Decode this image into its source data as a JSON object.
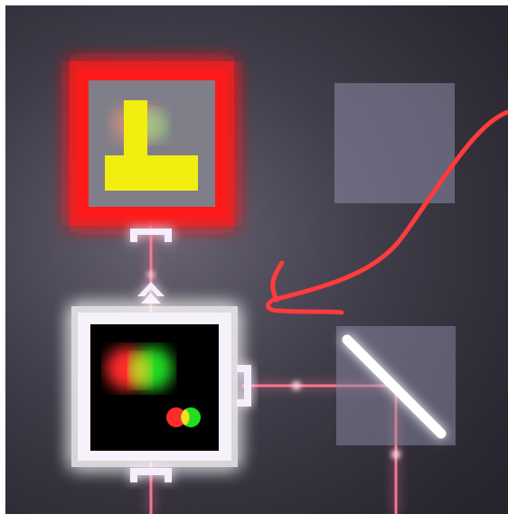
{
  "puzzle": {
    "background_color": "#4e4a5a",
    "laser_color": "#ff6b8a",
    "glow_color": "#f4eefc"
  },
  "tiles": [
    {
      "name": "target-receiver",
      "icon": "t-shaped-receiver-icon",
      "color": "#f2ee10",
      "status": "active",
      "border_color": "#ff1a1a"
    },
    {
      "name": "empty-slot-top-right",
      "icon": "empty-slot-icon",
      "status": "empty"
    },
    {
      "name": "color-mixer-source",
      "icon": "mixer-icon",
      "colors": [
        "#ff2a2a",
        "#22dd22"
      ],
      "status": "glowing"
    },
    {
      "name": "mirror-tile",
      "icon": "diagonal-mirror-icon",
      "orientation": "backslash"
    }
  ],
  "annotation": {
    "icon": "red-curved-arrow-icon",
    "color": "#ff3b3b"
  }
}
